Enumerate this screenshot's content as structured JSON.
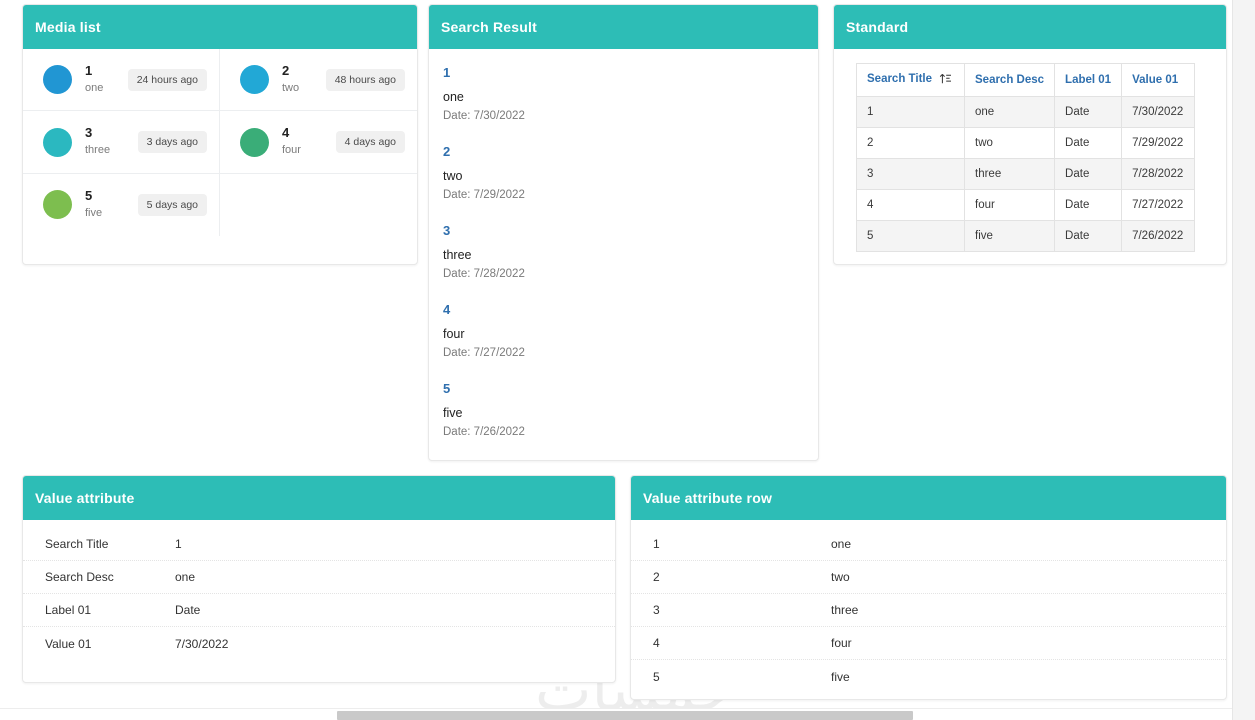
{
  "media_list": {
    "title": "Media list",
    "items": [
      {
        "title": "1",
        "subtitle": "one",
        "time": "24 hours ago",
        "color": "#2196d3"
      },
      {
        "title": "2",
        "subtitle": "two",
        "time": "48 hours ago",
        "color": "#22a8d6"
      },
      {
        "title": "3",
        "subtitle": "three",
        "time": "3 days ago",
        "color": "#2bb8c0"
      },
      {
        "title": "4",
        "subtitle": "four",
        "time": "4 days ago",
        "color": "#3aad78"
      },
      {
        "title": "5",
        "subtitle": "five",
        "time": "5 days ago",
        "color": "#7dbe4f"
      }
    ]
  },
  "search_result": {
    "title": "Search Result",
    "items": [
      {
        "link": "1",
        "desc": "one",
        "date": "Date: 7/30/2022"
      },
      {
        "link": "2",
        "desc": "two",
        "date": "Date: 7/29/2022"
      },
      {
        "link": "3",
        "desc": "three",
        "date": "Date: 7/28/2022"
      },
      {
        "link": "4",
        "desc": "four",
        "date": "Date: 7/27/2022"
      },
      {
        "link": "5",
        "desc": "five",
        "date": "Date: 7/26/2022"
      }
    ]
  },
  "standard": {
    "title": "Standard",
    "sort_icon": "sort-ascending-icon",
    "sorted_column": "Search Title",
    "columns": [
      "Search Title",
      "Search Desc",
      "Label 01",
      "Value 01"
    ],
    "rows": [
      [
        "1",
        "one",
        "Date",
        "7/30/2022"
      ],
      [
        "2",
        "two",
        "Date",
        "7/29/2022"
      ],
      [
        "3",
        "three",
        "Date",
        "7/28/2022"
      ],
      [
        "4",
        "four",
        "Date",
        "7/27/2022"
      ],
      [
        "5",
        "five",
        "Date",
        "7/26/2022"
      ]
    ]
  },
  "value_attribute": {
    "title": "Value attribute",
    "rows": [
      {
        "label": "Search Title",
        "value": "1"
      },
      {
        "label": "Search Desc",
        "value": "one"
      },
      {
        "label": "Label 01",
        "value": "Date"
      },
      {
        "label": "Value 01",
        "value": "7/30/2022"
      }
    ]
  },
  "value_attribute_row": {
    "title": "Value attribute row",
    "rows": [
      {
        "key": "1",
        "value": "one"
      },
      {
        "key": "2",
        "value": "two"
      },
      {
        "key": "3",
        "value": "three"
      },
      {
        "key": "4",
        "value": "four"
      },
      {
        "key": "5",
        "value": "five"
      }
    ]
  },
  "watermark": {
    "text": "خمسات"
  },
  "theme": {
    "header_teal": "#2dbdb6",
    "link_blue": "#2f6fae",
    "row_stripe": "#f4f4f4",
    "badge_bg": "#f0f0f0"
  }
}
